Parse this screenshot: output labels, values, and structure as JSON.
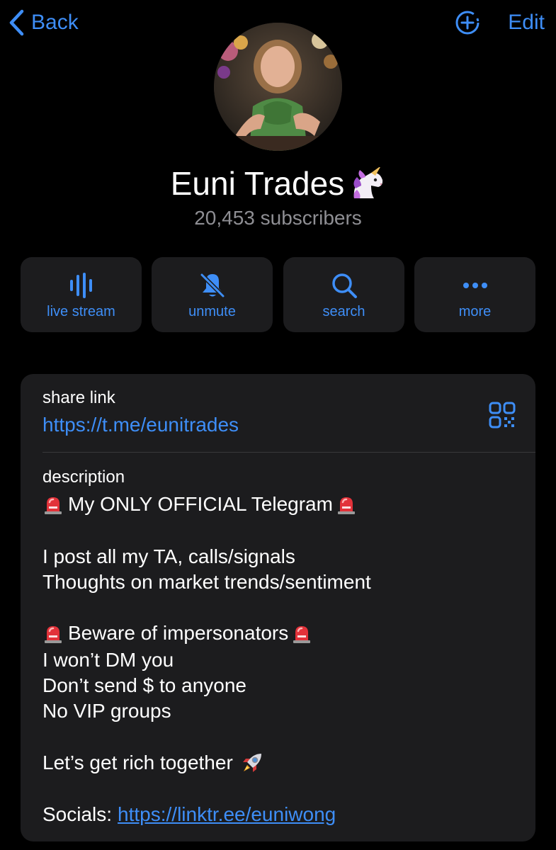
{
  "nav": {
    "back_label": "Back",
    "edit_label": "Edit"
  },
  "channel": {
    "name": "Euni Trades",
    "subscribers": "20,453 subscribers"
  },
  "actions": [
    {
      "label": "live stream",
      "icon": "live-stream-icon"
    },
    {
      "label": "unmute",
      "icon": "bell-muted-icon"
    },
    {
      "label": "search",
      "icon": "search-icon"
    },
    {
      "label": "more",
      "icon": "more-dots-icon"
    }
  ],
  "info": {
    "share_label": "share link",
    "share_url": "https://t.me/eunitrades",
    "description_label": "description",
    "description_lines": [
      "My ONLY OFFICIAL Telegram",
      "I post all my TA, calls/signals",
      "Thoughts on market trends/sentiment",
      "Beware of impersonators",
      "I won’t DM you",
      "Don’t send $ to anyone",
      "No VIP groups",
      "Let’s get rich together",
      "Socials:"
    ],
    "socials_url": "https://linktr.ee/euniwong"
  },
  "colors": {
    "accent": "#3e8ef7",
    "background": "#000000",
    "card": "#1c1c1e",
    "secondary_text": "#8e8e93"
  }
}
